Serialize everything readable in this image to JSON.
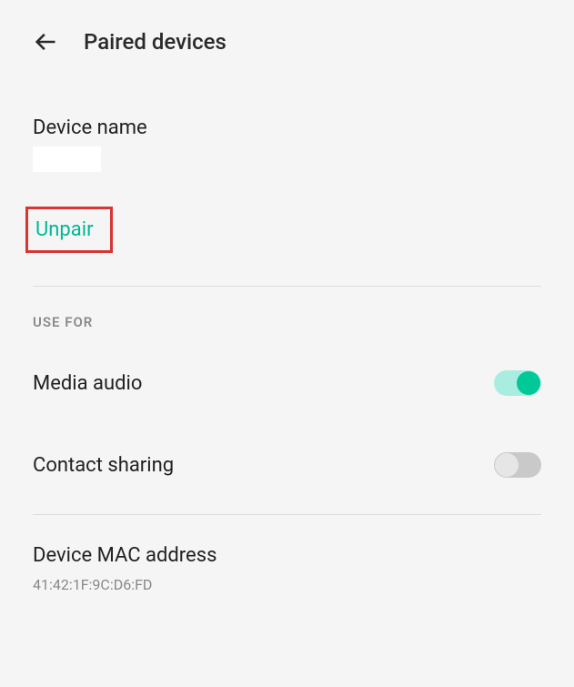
{
  "header": {
    "title": "Paired devices"
  },
  "device": {
    "name_label": "Device name",
    "name_value": ""
  },
  "actions": {
    "unpair": "Unpair"
  },
  "use_for": {
    "header": "USE FOR",
    "media_audio": {
      "label": "Media audio",
      "enabled": true
    },
    "contact_sharing": {
      "label": "Contact sharing",
      "enabled": false
    }
  },
  "mac": {
    "label": "Device MAC address",
    "value": "41:42:1F:9C:D6:FD"
  }
}
